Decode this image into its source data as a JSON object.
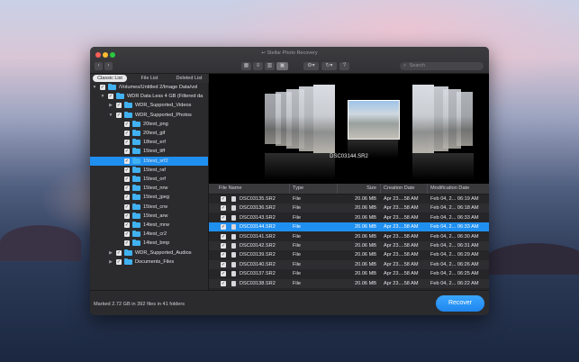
{
  "window": {
    "title": "Stellar Photo Recovery"
  },
  "toolbar": {
    "back_icon": "chevron-left-icon",
    "forward_icon": "chevron-right-icon",
    "view_buttons": [
      "grid-view-icon",
      "list-view-icon",
      "column-view-icon",
      "coverflow-view-icon"
    ],
    "settings_icon": "gear-icon",
    "history_icon": "history-icon",
    "help_label": "?",
    "search_placeholder": "Search"
  },
  "tabs": [
    "Classic List",
    "File List",
    "Deleted List"
  ],
  "tree": [
    {
      "label": "/Volumes/Untitled 2/Image Data/vol",
      "indent": 0,
      "expanded": true
    },
    {
      "label": "WDR Data Less 4 GB (Filtered da",
      "indent": 1,
      "expanded": true
    },
    {
      "label": "WDR_Supported_Videos",
      "indent": 2,
      "expanded": false
    },
    {
      "label": "WDR_Supported_Photos",
      "indent": 2,
      "expanded": true
    },
    {
      "label": "20test_png",
      "indent": 3
    },
    {
      "label": "20test_gif",
      "indent": 3
    },
    {
      "label": "18test_erf",
      "indent": 3
    },
    {
      "label": "15test_tiff",
      "indent": 3
    },
    {
      "label": "15test_srf2",
      "indent": 3,
      "selected": true
    },
    {
      "label": "15test_raf",
      "indent": 3
    },
    {
      "label": "15test_orf",
      "indent": 3
    },
    {
      "label": "15test_nrw",
      "indent": 3
    },
    {
      "label": "15test_jpeg",
      "indent": 3
    },
    {
      "label": "15test_crw",
      "indent": 3
    },
    {
      "label": "15test_arw",
      "indent": 3
    },
    {
      "label": "14test_mrw",
      "indent": 3
    },
    {
      "label": "14test_cr2",
      "indent": 3
    },
    {
      "label": "14test_bmp",
      "indent": 3
    },
    {
      "label": "WDR_Supported_Audios",
      "indent": 2,
      "expanded": false
    },
    {
      "label": "Documents_Files",
      "indent": 2,
      "expanded": false
    }
  ],
  "preview": {
    "caption": "DSC03144.SR2"
  },
  "table": {
    "columns": [
      "File Name",
      "Type",
      "Size",
      "Creation Date",
      "Modification Date"
    ],
    "rows": [
      [
        "DSC03135.SR2",
        "File",
        "20.06 MB",
        "Apr 23....58 AM",
        "Feb 04, 2... 06:19 AM"
      ],
      [
        "DSC03136.SR2",
        "File",
        "20.06 MB",
        "Apr 23....58 AM",
        "Feb 04, 2... 06:18 AM"
      ],
      [
        "DSC03143.SR2",
        "File",
        "20.06 MB",
        "Apr 23....58 AM",
        "Feb 04, 2... 06:33 AM"
      ],
      [
        "DSC03144.SR2",
        "File",
        "20.06 MB",
        "Apr 23....58 AM",
        "Feb 04, 2... 06:33 AM"
      ],
      [
        "DSC03141.SR2",
        "File",
        "20.06 MB",
        "Apr 23....58 AM",
        "Feb 04, 2... 06:30 AM"
      ],
      [
        "DSC03142.SR2",
        "File",
        "20.06 MB",
        "Apr 23....58 AM",
        "Feb 04, 2... 06:31 AM"
      ],
      [
        "DSC03139.SR2",
        "File",
        "20.06 MB",
        "Apr 23....58 AM",
        "Feb 04, 2... 06:29 AM"
      ],
      [
        "DSC03140.SR2",
        "File",
        "20.06 MB",
        "Apr 23....58 AM",
        "Feb 04, 2... 06:26 AM"
      ],
      [
        "DSC03137.SR2",
        "File",
        "20.06 MB",
        "Apr 23....58 AM",
        "Feb 04, 2... 06:25 AM"
      ],
      [
        "DSC03138.SR2",
        "File",
        "20.06 MB",
        "Apr 23....58 AM",
        "Feb 04, 2... 06:22 AM"
      ]
    ],
    "selected_index": 3
  },
  "status": {
    "text": "Marked 2.72 GB in 392 files in 41 folders"
  },
  "recover_button": {
    "label": "Recover"
  },
  "colors": {
    "accent": "#1f8ff0",
    "folder": "#41b1f2"
  }
}
